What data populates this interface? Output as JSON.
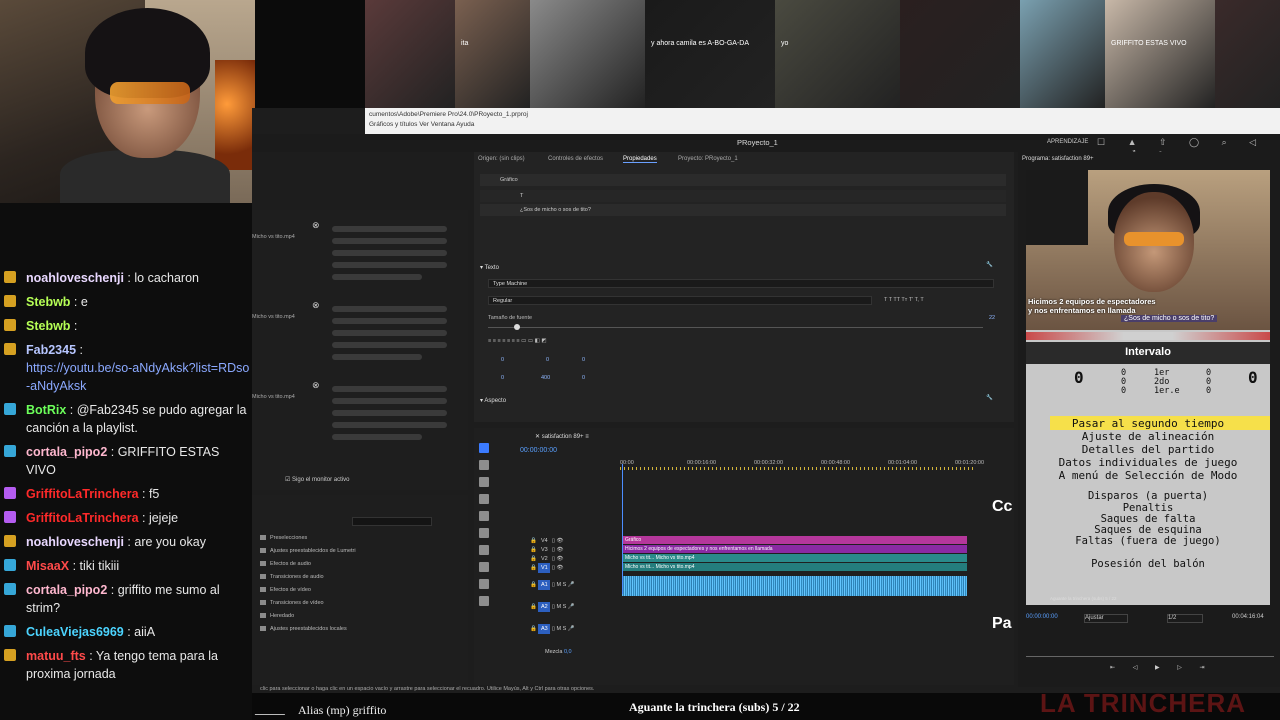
{
  "chat": {
    "messages": [
      {
        "user": "noahloveschenji",
        "text": ": lo cacharon",
        "color": "#e9d8ff",
        "badge": "#d5a021"
      },
      {
        "user": "Stebwb",
        "text": ": e",
        "color": "#b6ff56",
        "badge": "#d5a021"
      },
      {
        "user": "Stebwb",
        "text": ":",
        "color": "#b6ff56",
        "badge": "#d5a021"
      },
      {
        "user": "Fab2345",
        "text": ":",
        "link": "https://youtu.be/so-aNdyAksk?list=RDso-aNdyAksk",
        "color": "#b7c6ff",
        "badge": "#d5a021"
      },
      {
        "user": "BotRix",
        "text": ": @Fab2345",
        "text2": "se pudo agregar la canción a la playlist.",
        "color": "#6cff5a",
        "badge": "#36a7d8"
      },
      {
        "user": "cortala_pipo2",
        "text": ": GRIFFITO ESTAS VIVO",
        "color": "#ffb8cf",
        "badge": "#36a7d8"
      },
      {
        "user": "GriffitoLaTrinchera",
        "text": ": f5",
        "color": "#ff2a2a",
        "badge": "#b45cf0"
      },
      {
        "user": "GriffitoLaTrinchera",
        "text": ": jejeje",
        "color": "#ff2a2a",
        "badge": "#b45cf0"
      },
      {
        "user": "noahloveschenji",
        "text": ": are you okay",
        "color": "#e9d8ff",
        "badge": "#d5a021"
      },
      {
        "user": "MisaaX",
        "text": ": tiki tikiii",
        "color": "#ff4a4a",
        "badge": "#36a7d8"
      },
      {
        "user": "cortala_pipo2",
        "text": ": griffito me sumo al strim?",
        "color": "#ffb8cf",
        "badge": "#36a7d8"
      },
      {
        "user": "CuleaViejas6969",
        "text": ": aiiA",
        "color": "#4cd4ff",
        "badge": "#36a7d8"
      },
      {
        "user": "matuu_fts",
        "text": ": Ya tengo tema para la proxima jornada",
        "color": "#ff4a4a",
        "badge": "#d5a021"
      }
    ]
  },
  "collage": {
    "tiles": [
      {
        "color": "#5a3a3a",
        "label": ""
      },
      {
        "color": "#7a6050",
        "label": "ita"
      },
      {
        "color": "#8a8a8a",
        "label": ""
      },
      {
        "color": "#1a1a1a",
        "label": "y ahora camila es A-BO-GA-DA"
      },
      {
        "color": "#4a4a40",
        "label": "yo"
      },
      {
        "color": "#2a1f1f",
        "label": ""
      },
      {
        "color": "#7aa0b0",
        "label": ""
      },
      {
        "color": "#c8b8a8",
        "label": "GRIFFITO ESTAS VIVO"
      },
      {
        "color": "#3a2a2a",
        "label": ""
      }
    ]
  },
  "premiere": {
    "menu_path": "cumentos\\Adobe\\Premiere Pro\\24.0\\PRoyecto_1.prproj",
    "menu_items": "Gráficos y títulos   Ver   Ventana   Ayuda",
    "project_title": "PRoyecto_1",
    "workspace": "APRENDIZAJE",
    "tabs": [
      "Origen: (sin clips)",
      "Controles de efectos",
      "Propiedades",
      "Proyecto: PRoyecto_1"
    ],
    "graphic_label": "Gráfico",
    "text_layer": "¿Sos de micho o sos de tito?",
    "texto_section": "Texto",
    "font_name": "Type Machine",
    "font_style": "Regular",
    "font_size_label": "Tamaño de fuente",
    "font_size_value": "22",
    "aspecto_section": "Aspecto",
    "spacing_values": [
      "0",
      "0",
      "0",
      "0",
      "400",
      "0"
    ],
    "media_items": [
      "Micho vs tito.mp4",
      "Micho vs tito.mp4",
      "Micho vs tito.mp4"
    ],
    "monitor_check": "Sigo el monitor activo",
    "sequence_tab": "satisfaction 89+",
    "effects_items": [
      "Preselecciones",
      "Ajustes preestablecidos de Lumetri",
      "Efectos de audio",
      "Transiciones de audio",
      "Efectos de vídeo",
      "Transiciones de vídeo",
      "Heredado",
      "Ajustes preestablecidos locales"
    ],
    "sequence_name": "satisfaction 89+",
    "timecode": "00:00:00:00",
    "ruler_ticks": [
      "00:00",
      "00:00:16:00",
      "00:00:32:00",
      "00:00:48:00",
      "00:01:04:00",
      "00:01:20:00"
    ],
    "tracks": [
      "V4",
      "V3",
      "V2",
      "V1",
      "A1",
      "A2",
      "A3"
    ],
    "clip_grafico": "Gráfico",
    "clip_text": "Hicimos 2 equipos de espectadores y nos enfrentamos en llamada",
    "clip_video": "Micho vs tit...",
    "clip_video_long": "Micho vs tito.mp4",
    "mezcla_label": "Mezcla",
    "mezcla_value": "0,0",
    "status": "clic para seleccionar o haga clic en un espacio vacío y arrastre para seleccionar el recuadro. Utilice Mayús, Alt y Ctrl para otras opciones."
  },
  "program": {
    "title": "Programa: satisfaction 89+",
    "caption1": "Hicimos 2 equipos de espectadores",
    "caption2": "y nos enfrentamos en llamada",
    "question": "¿Sos de micho o sos de tito?",
    "intervalo": "Intervalo",
    "score_left": "0",
    "score_right": "0",
    "stats": [
      {
        "l": "0",
        "m": "1er",
        "r": "0"
      },
      {
        "l": "0",
        "m": "2do",
        "r": "0"
      },
      {
        "l": "0",
        "m": "1er.e",
        "r": "0"
      }
    ],
    "menu": [
      "Pasar al segundo tiempo",
      "Ajuste de alineación",
      "Detalles del partido",
      "Datos individuales de juego",
      "A menú de Selección de Modo",
      "Disparos (a puerta)",
      "Penaltis",
      "Saques de falta",
      "Saques de esquina",
      "Faltas (fuera de juego)",
      "Posesión del balón"
    ],
    "footer": "Aguante la trinchera (subs) 5 / 22",
    "tc_start": "00:00:00:00",
    "fit": "Ajustar",
    "resolution": "1/2",
    "tc_end": "00:04:16:04"
  },
  "overlay": {
    "cc": "Cc",
    "pa": "Pa",
    "alias": "Alias (mp) griffito",
    "episode": "Aguante la trinchera (subs) 5 / 22",
    "brand": "LA TRINCHERA"
  }
}
